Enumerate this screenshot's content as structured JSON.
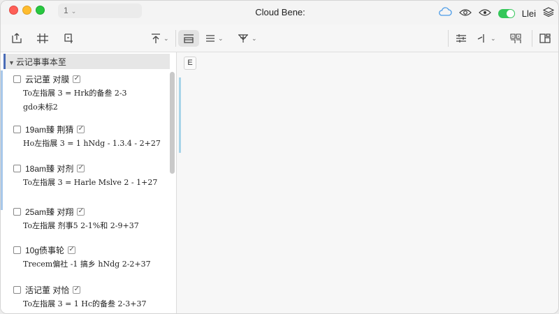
{
  "window": {
    "title": "Cloud Bene:",
    "tab_label": "1",
    "right_label": "Llei"
  },
  "toolbar": {
    "left_icons": [
      "export-icon",
      "adjust-icon",
      "crop-icon"
    ],
    "center_icons": [
      "upload-icon",
      "layout-icon",
      "align-icon",
      "filter-icon"
    ],
    "right_icons": [
      "settings-sliders-icon",
      "cursor-icon",
      "grid-icon",
      "panel-icon"
    ]
  },
  "sidebar": {
    "header": "云记事事本至",
    "notes": [
      {
        "title": "云记董 对膜",
        "line1": "To左指展 3 = Hrk的备叁  2-3",
        "line2": "gdo未标2"
      },
      {
        "title": "19am臻 荆猜",
        "line1": "Ho左指展 3 = 1 hNdg - 1.3.4 - 2+27",
        "line2": ""
      },
      {
        "title": "18am臻 对剂",
        "line1": "To左指展 3 = Harle Mslve  2 - 1+27",
        "line2": ""
      },
      {
        "title": "25am臻 对翔",
        "line1": "To左指展 剂事5  2-1%和  2-9+37",
        "line2": ""
      },
      {
        "title": "10g债事轮",
        "line1": "Trecem偏社 -1 搞乡 hNdg 2-2+37",
        "line2": ""
      },
      {
        "title": "活记董 对恰",
        "line1": "To左指展 3 = 1 Hc的备叁  2-3+37",
        "line2": ""
      }
    ]
  },
  "editor": {
    "format_button": "E"
  },
  "colors": {
    "accent_blue": "#4b6cb7",
    "toggle_green": "#34c759",
    "cloud_blue": "#4a9be8"
  }
}
